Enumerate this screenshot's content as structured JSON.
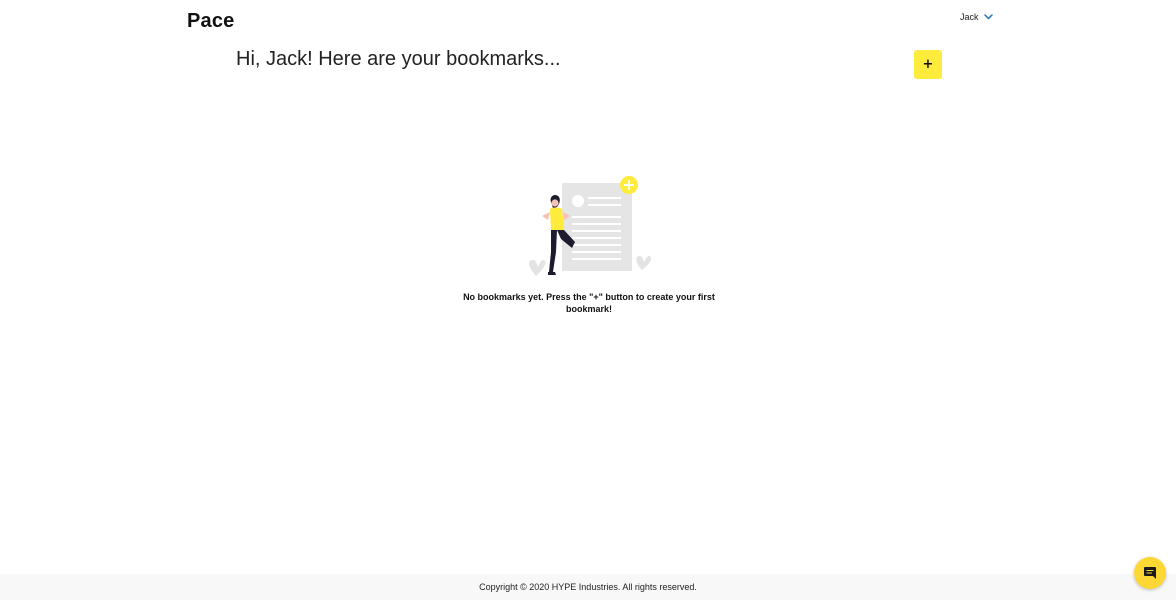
{
  "header": {
    "logo": "Pace",
    "user_name": "Jack"
  },
  "main": {
    "greeting": "Hi, Jack! Here are your bookmarks...",
    "add_button_label": "+",
    "empty_message": "No bookmarks yet. Press the \"+\" button to create your first bookmark!"
  },
  "footer": {
    "copyright": "Copyright © 2020 HYPE Industries. All rights reserved."
  },
  "colors": {
    "accent": "#ffeb3b",
    "chat": "#fdd835"
  },
  "icons": {
    "user_menu": "chevron-down-icon",
    "chat": "chat-bubble-icon",
    "illustration": "empty-bookmarks-illustration"
  }
}
